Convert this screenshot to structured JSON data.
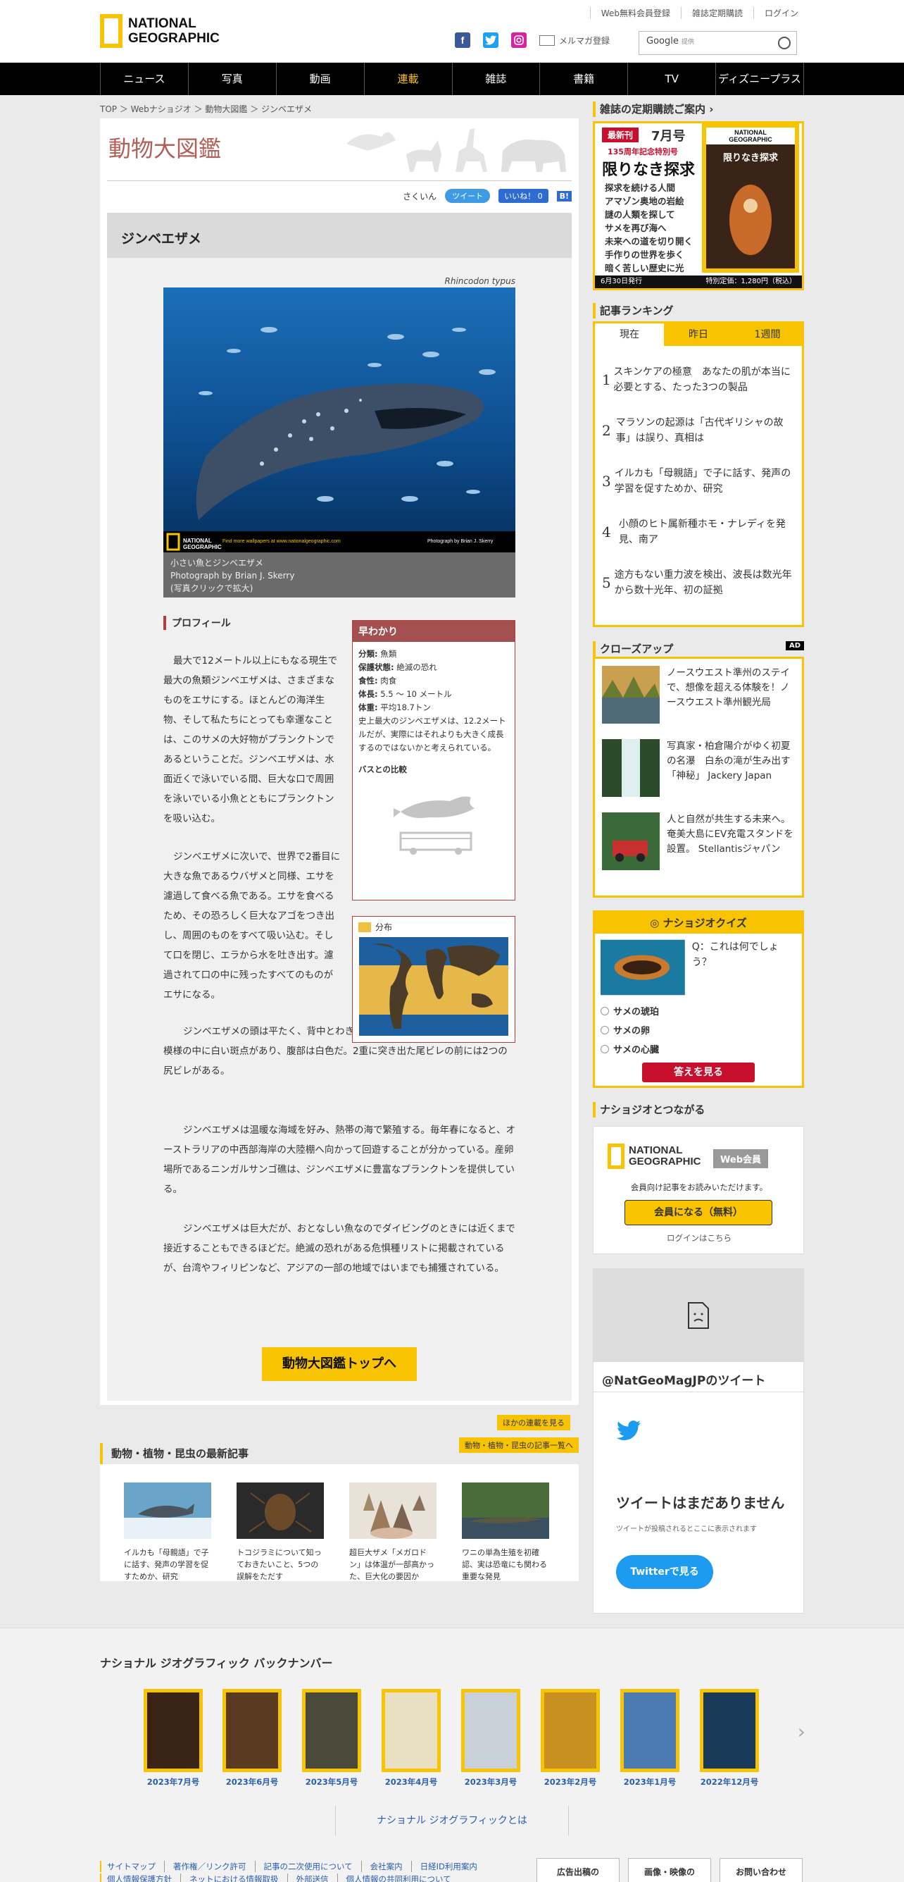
{
  "header": {
    "logo_line1": "NATIONAL",
    "logo_line2": "GEOGRAPHIC",
    "top_links": [
      "Web無料会員登録",
      "雑誌定期購読",
      "ログイン"
    ],
    "mailmag": "メルマガ登録",
    "search_brand": "Google",
    "search_sub": "提供"
  },
  "nav": [
    "ニュース",
    "写真",
    "動画",
    "連載",
    "雑誌",
    "書籍",
    "TV",
    "ディズニープラス"
  ],
  "breadcrumb": "TOP ＞ Webナショジオ ＞ 動物大図鑑 ＞ ジンベエザメ",
  "zukan": {
    "title": "動物大図鑑",
    "sakuin": "さくいん",
    "tweet": "ツイート",
    "like": "いいね！ 0",
    "hatena": "B!"
  },
  "article": {
    "name": "ジンベエザメ",
    "scientific": "Rhincodon typus",
    "photo_credit_line": "Find more wallpapers at www.nationalgeographic.com",
    "photo_credit_right": "Photograph by Brian J. Skerry",
    "caption": [
      "小さい魚とジンベエザメ",
      "Photograph by Brian J. Skerry",
      "(写真クリックで拡大)"
    ],
    "profile_head": "プロフィール",
    "p1": "最大で12メートル以上にもなる現生で最大の魚類ジンベエザメは、さまざまなものをエサにする。ほとんどの海洋生物、そして私たちにとっても幸運なことは、このサメの大好物がプランクトンであるということだ。ジンベエザメは、水面近くで泳いでいる間、巨大な口で周囲を泳いでいる小魚とともにプランクトンを吸い込む。",
    "p2": "ジンベエザメに次いで、世界で2番目に大きな魚であるウバザメと同様、エサを濾過して食べる魚である。エサを食べるため、その恐ろしく巨大なアゴをつき出し、周囲のものをすべて吸い込む。そして口を閉じ、エラから水を吐き出す。濾過されて口の中に残ったすべてのものがエサになる。",
    "p3": "ジンベエザメの頭は平たく、背中とわき腹は灰色や茶色で、青白い縦横とし字模様の中に白い斑点があり、腹部は白色だ。2重に突き出た尾ビレの前には2つの尻ビレがある。",
    "p4": "ジンベエザメは温暖な海域を好み、熱帯の海で繁殖する。毎年春になると、オーストラリアの中西部海岸の大陸棚へ向かって回遊することが分かっている。産卵場所であるニンガルサンゴ礁は、ジンベエザメに豊富なプランクトンを提供している。",
    "p5": "ジンベエザメは巨大だが、おとなしい魚なのでダイビングのときには近くまで接近することもできるほどだ。絶滅の恐れがある危惧種リストに掲載されているが、台湾やフィリピンなど、アジアの一部の地域ではいまでも捕獲されている。",
    "top_button": "動物大図鑑トップへ"
  },
  "hayawakari": {
    "title": "早わかり",
    "facts": [
      {
        "k": "分類:",
        "v": " 魚類"
      },
      {
        "k": "保護状態:",
        "v": " 絶滅の恐れ"
      },
      {
        "k": "食性:",
        "v": " 肉食"
      },
      {
        "k": "体長:",
        "v": " 5.5 〜 10 メートル"
      },
      {
        "k": "体重:",
        "v": " 平均18.7トン"
      }
    ],
    "note": "史上最大のジンベエザメは、12.2メートルだが、実際にはそれよりも大きく成長するのではないかと考えられている。",
    "bus_title": "バスとの比較",
    "dist_label": "分布"
  },
  "more_rensai": "ほかの連載を見る",
  "latest": {
    "head": "動物・植物・昆虫の最新記事",
    "all": "動物・植物・昆虫の記事一覧へ",
    "items": [
      "イルカも「母親語」で子に話す、発声の学習を促すためか、研究",
      "トコジラミについて知っておきたいこと、5つの誤解をただす",
      "超巨大ザメ「メガロドン」は体温が一部高かった、巨大化の要因か",
      "ワニの単為生殖を初確認、実は恐竜にも関わる重要な発見"
    ]
  },
  "sidebar": {
    "mag_head": "雑誌の定期購読ご案内",
    "mag_new": "最新刊",
    "mag_issue": "7月号",
    "mag_special": "135周年記念特別号",
    "mag_title": "限りなき探求",
    "mag_lines": [
      "探求を続ける人間",
      "アマゾン奥地の岩絵",
      "謎の人類を探して",
      "サメを再び海へ",
      "未来への道を切り開く",
      "手作りの世界を歩く",
      "暗く苦しい歴史に光"
    ],
    "mag_date": "6月30日発行",
    "mag_price": "特別定価：1,280円（税込）",
    "rank_head": "記事ランキング",
    "rank_tabs": [
      "現在",
      "昨日",
      "1週間"
    ],
    "ranks": [
      "スキンケアの極意　あなたの肌が本当に必要とする、たった3つの製品",
      "マラソンの起源は「古代ギリシャの故事」は誤り、真相は",
      "イルカも「母親語」で子に話す、発声の学習を促すためか、研究",
      "小顔のヒト属新種ホモ・ナレディを発見、南ア",
      "途方もない重力波を検出、波長は数光年から数十光年、初の証拠"
    ],
    "closeup_head": "クローズアップ",
    "ad": "AD",
    "closeups": [
      "ノースウエスト準州のステイで、想像を超える体験を！ノースウエスト準州観光局",
      "写真家・柏倉陽介がゆく初夏の名瀑　白糸の滝が生み出す「神秘」 Jackery Japan",
      "人と自然が共生する未来へ。奄美大島にEV充電スタンドを設置。 Stellantisジャパン"
    ],
    "quiz_head": "ナショジオクイズ",
    "quiz_q": "Q：これは何でしょう？",
    "quiz_opts": [
      "サメの琥珀",
      "サメの卵",
      "サメの心臓"
    ],
    "quiz_btn": "答えを見る",
    "connect_head": "ナショジオとつながる",
    "member_badge": "Web会員",
    "member_text": "会員向け記事をお読みいただけます。",
    "member_btn": "会員になる（無料）",
    "login": "ログインはこちら",
    "tw_handle": "@NatGeoMagJPのツイート",
    "tw_big": "ツイートはまだありません",
    "tw_small": "ツイートが投稿されるとここに表示されます",
    "tw_btn": "Twitterで見る"
  },
  "backnumber": {
    "title": "ナショナル ジオグラフィック バックナンバー",
    "issues": [
      "2023年7月号",
      "2023年6月号",
      "2023年5月号",
      "2023年4月号",
      "2023年3月号",
      "2023年2月号",
      "2023年1月号",
      "2022年12月号"
    ],
    "about": "ナショナル ジオグラフィックとは",
    "links1": [
      "サイトマップ",
      "著作権／リンク許可",
      "記事の二次使用について",
      "会社案内",
      "日経ID利用案内"
    ],
    "links2": [
      "個人情報保護方針",
      "ネットにおける情報取扱",
      "外部送信",
      "個人情報の共同利用について"
    ],
    "btns": [
      "広告出稿の",
      "画像・映像の",
      "お問い合わせ"
    ]
  },
  "colors": {
    "accent": "#f8c300",
    "nav_bg": "#000000",
    "title_red": "#b36058"
  }
}
